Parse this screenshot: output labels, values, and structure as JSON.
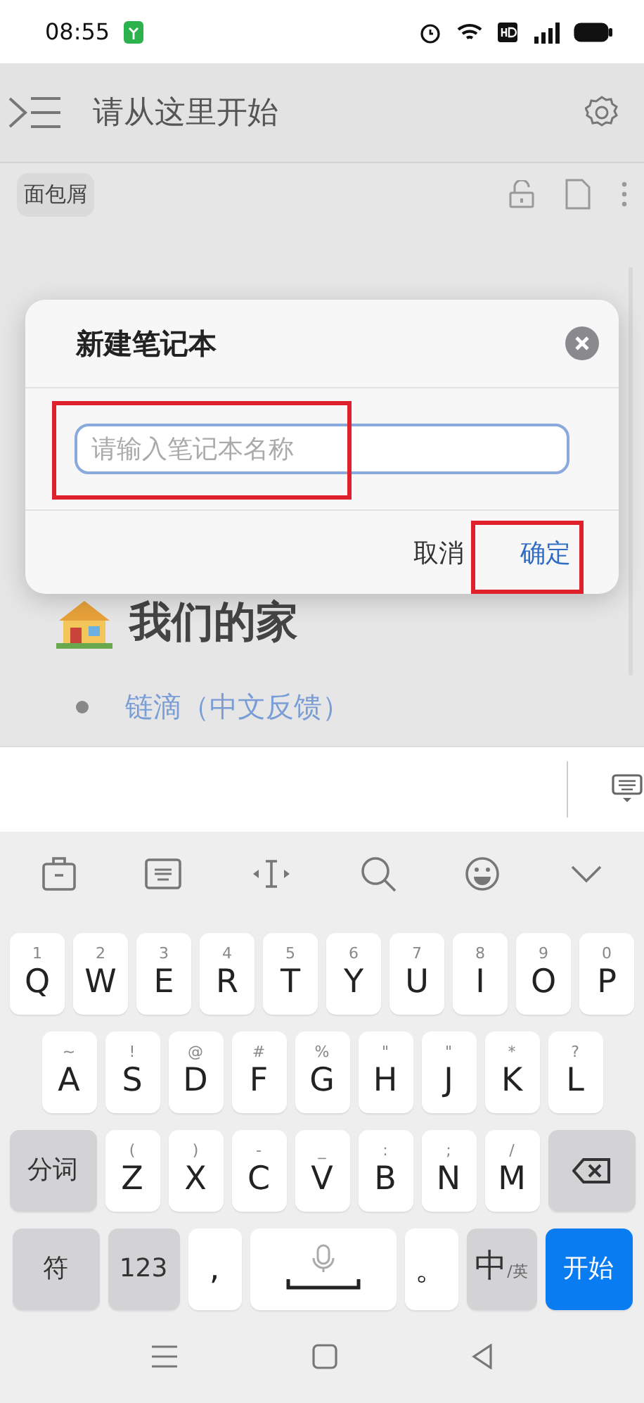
{
  "status_bar": {
    "time": "08:55"
  },
  "header": {
    "title": "请从这里开始"
  },
  "breadcrumb": {
    "label": "面包屑"
  },
  "content": {
    "heading": "我们的家",
    "links": [
      "链滴（中文反馈）"
    ]
  },
  "dialog": {
    "title": "新建笔记本",
    "input": {
      "placeholder": "请输入笔记本名称"
    },
    "buttons": [
      {
        "label": "取消",
        "primary": false
      },
      {
        "label": "确定",
        "primary": true
      }
    ]
  },
  "keyboard": {
    "rows": [
      {
        "keys": [
          {
            "kind": "letter",
            "hint": "1",
            "label": "Q"
          },
          {
            "kind": "letter",
            "hint": "2",
            "label": "W"
          },
          {
            "kind": "letter",
            "hint": "3",
            "label": "E"
          },
          {
            "kind": "letter",
            "hint": "4",
            "label": "R"
          },
          {
            "kind": "letter",
            "hint": "5",
            "label": "T"
          },
          {
            "kind": "letter",
            "hint": "6",
            "label": "Y"
          },
          {
            "kind": "letter",
            "hint": "7",
            "label": "U"
          },
          {
            "kind": "letter",
            "hint": "8",
            "label": "I"
          },
          {
            "kind": "letter",
            "hint": "9",
            "label": "O"
          },
          {
            "kind": "letter",
            "hint": "0",
            "label": "P"
          }
        ]
      },
      {
        "keys": [
          {
            "kind": "letter",
            "hint": "~",
            "label": "A"
          },
          {
            "kind": "letter",
            "hint": "!",
            "label": "S"
          },
          {
            "kind": "letter",
            "hint": "@",
            "label": "D"
          },
          {
            "kind": "letter",
            "hint": "#",
            "label": "F"
          },
          {
            "kind": "letter",
            "hint": "%",
            "label": "G"
          },
          {
            "kind": "letter",
            "hint": "\"",
            "label": "H"
          },
          {
            "kind": "letter",
            "hint": "\"",
            "label": "J"
          },
          {
            "kind": "letter",
            "hint": "*",
            "label": "K"
          },
          {
            "kind": "letter",
            "hint": "?",
            "label": "L"
          }
        ]
      },
      {
        "keys": [
          {
            "kind": "function",
            "label": "分词"
          },
          {
            "kind": "letter",
            "hint": "(",
            "label": "Z"
          },
          {
            "kind": "letter",
            "hint": ")",
            "label": "X"
          },
          {
            "kind": "letter",
            "hint": "-",
            "label": "C"
          },
          {
            "kind": "letter",
            "hint": "_",
            "label": "V"
          },
          {
            "kind": "letter",
            "hint": ":",
            "label": "B"
          },
          {
            "kind": "letter",
            "hint": ";",
            "label": "N"
          },
          {
            "kind": "letter",
            "hint": "/",
            "label": "M"
          },
          {
            "kind": "backspace"
          }
        ]
      },
      {
        "keys": [
          {
            "kind": "function",
            "label": "符"
          },
          {
            "kind": "function",
            "label": "123"
          },
          {
            "kind": "letter",
            "label": ","
          },
          {
            "kind": "space"
          },
          {
            "kind": "letter",
            "label": "。"
          },
          {
            "kind": "lang",
            "label": "中",
            "sub": "/英"
          },
          {
            "kind": "enter",
            "label": "开始"
          }
        ]
      }
    ]
  }
}
